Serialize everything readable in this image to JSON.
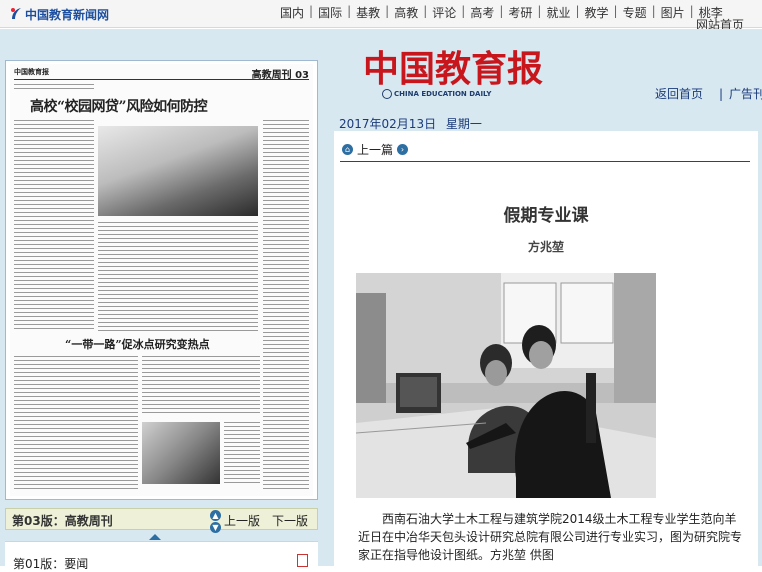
{
  "topbar": {
    "site_name": "中国教育新闻网",
    "nav": [
      "国内",
      "国际",
      "基教",
      "高教",
      "评论",
      "高考",
      "考研",
      "就业",
      "教学",
      "专题",
      "图片",
      "桃李"
    ],
    "extra": "网站首页"
  },
  "newspaper": {
    "mast_left": "中国教育报",
    "mast_right": "高教周刊 03",
    "headline": "高校“校园网贷”风险如何防控",
    "subhead": "“一带一路”促冰点研究变热点"
  },
  "edition": {
    "current_label": "第03版：",
    "current_name": "高教周刊",
    "prev": "上一版",
    "next": "下一版"
  },
  "edition_list": {
    "first_item": "第01版：要闻"
  },
  "header": {
    "logo": "中国教育报",
    "logo_en": "CHINA EDUCATION DAILY",
    "home_link": "返回首页",
    "ad_link": "广告刊例",
    "date": "2017年02月13日",
    "weekday": "星期一"
  },
  "article": {
    "prev": "上一篇",
    "title": "假期专业课",
    "author": "方兆堃",
    "caption": "西南石油大学土木工程与建筑学院2014级土木工程专业学生范向羊近日在中冶华天包头设计研究总院有限公司进行专业实习，图为研究院专家正在指导他设计图纸。方兆堃 供图"
  },
  "colors": {
    "nav_blue": "#1a3a7a",
    "logo_red": "#c8161d",
    "panel_bg": "#d8e8f1"
  }
}
